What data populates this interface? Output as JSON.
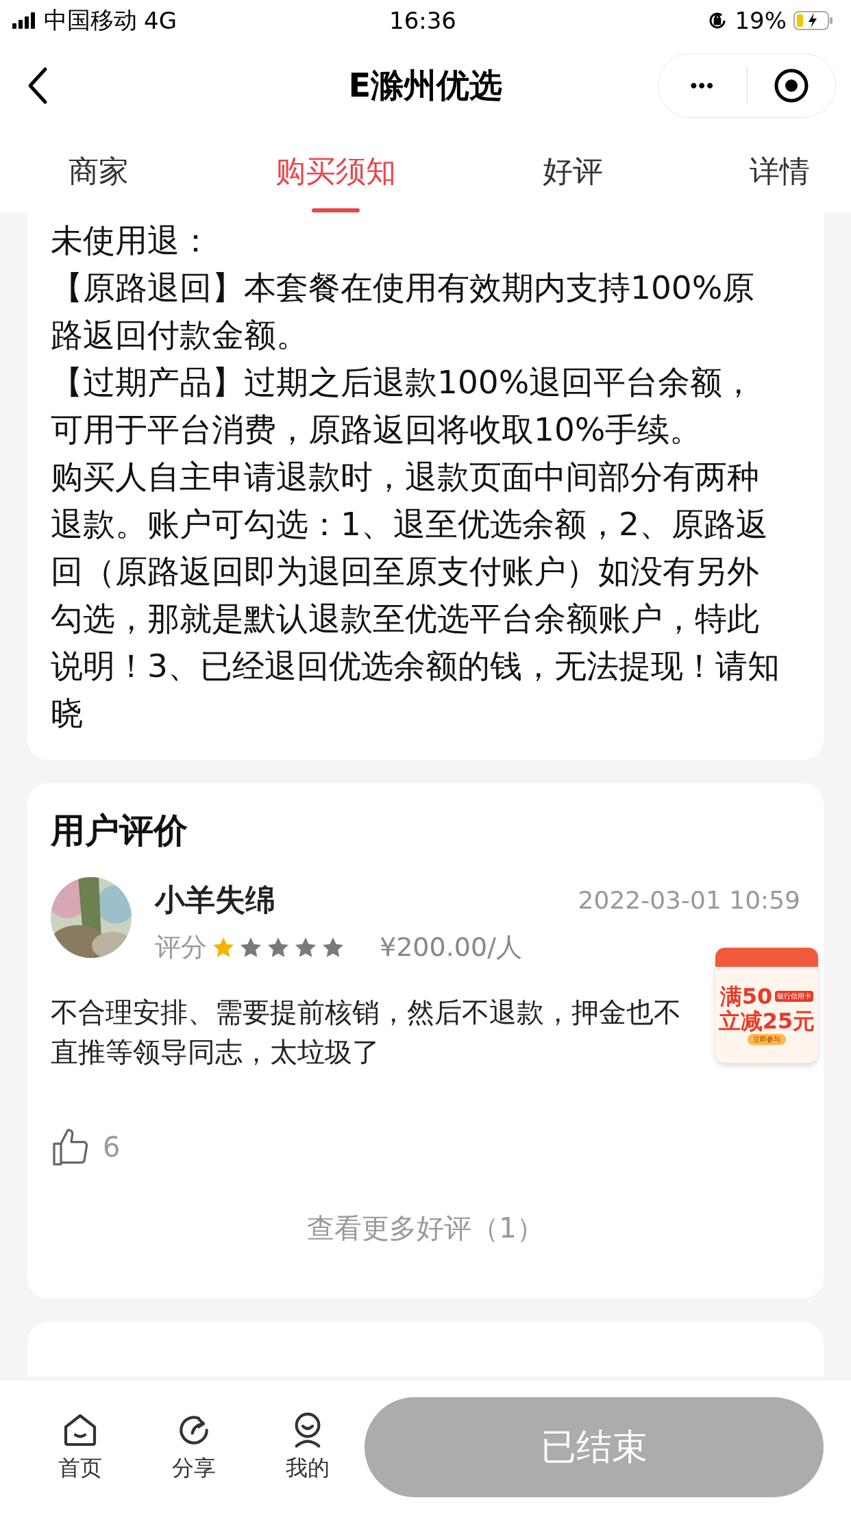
{
  "status_bar": {
    "carrier": "中国移动",
    "network": "4G",
    "time": "16:36",
    "battery": "19%"
  },
  "nav": {
    "title": "E滁州优选",
    "menu": "•••"
  },
  "tabs": [
    {
      "label": "商家",
      "selected": false
    },
    {
      "label": "购买须知",
      "selected": true
    },
    {
      "label": "好评",
      "selected": false
    },
    {
      "label": "详情",
      "selected": false
    }
  ],
  "notice": {
    "paragraphs": [
      "未使用退：",
      "【原路退回】本套餐在使用有效期内支持100%原路返回付款金额。",
      "【过期产品】过期之后退款100%退回平台余额，可用于平台消费，原路返回将收取10%手续。",
      "购买人自主申请退款时，退款页面中间部分有两种退款。账户可勾选：1、退至优选余额，2、原路返回（原路返回即为退回至原支付账户）如没有另外勾选，那就是默认退款至优选平台余额账户，特此说明！3、已经退回优选余额的钱，无法提现！请知晓"
    ]
  },
  "reviews": {
    "title": "用户评价",
    "items": [
      {
        "avatar": {
          "kind": "picture"
        },
        "name": "小羊失绵",
        "date": "2022-03-01 10:59",
        "rating_label": "评分",
        "stars": 1,
        "price": "¥200.00/人",
        "lines": [
          "不合理安排、需要提前核销，然后不退款，押金也不",
          "直推等领导同志，太垃圾了"
        ],
        "likes": "6"
      }
    ],
    "more": "查看更多好评（1）"
  },
  "promo": {
    "line_1": "满50",
    "tag": "银行信用卡",
    "line_2": "立减25元",
    "action": "立即参与"
  },
  "bottom_bar": {
    "items": [
      {
        "kind": "home",
        "label": "首页"
      },
      {
        "kind": "share",
        "label": "分享"
      },
      {
        "kind": "profile",
        "label": "我的"
      }
    ],
    "button": {
      "label": "已结束",
      "disabled": true
    }
  }
}
